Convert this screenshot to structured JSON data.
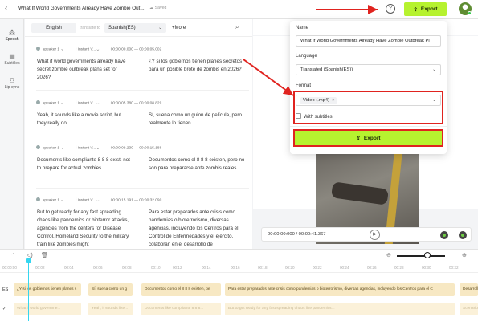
{
  "topbar": {
    "back_icon": "chevron-left-icon",
    "title": "What If World Governments Already Have Zombie Out...",
    "saved": "Saved",
    "help_glyph": "?",
    "export_label": "Export"
  },
  "rail": [
    {
      "label": "Speech",
      "icon": "speech-icon"
    },
    {
      "label": "Subtitles",
      "icon": "subtitles-icon"
    },
    {
      "label": "Lip-sync",
      "icon": "lipsync-icon"
    }
  ],
  "transcript": {
    "source_lang": "English",
    "to_label": "translate to",
    "target_lang": "Spanish(ES)",
    "more_label": "+More",
    "segments": [
      {
        "speaker": "speaker 1",
        "voice": "Instant V...",
        "start": "00:00:00.000",
        "end": "00:00:05.002",
        "en": "What if world governments already have secret zombie outbreak plans set for 2026?",
        "es": "¿Y si los gobiernos tienen planes secretos para un posible brote de zombis en 2026?"
      },
      {
        "speaker": "speaker 1",
        "voice": "Instant V...",
        "start": "00:00:05.380",
        "end": "00:00:08.829",
        "en": "Yeah, it sounds like a movie script, but they really do.",
        "es": "Sí, suena como un guion de película, pero realmente lo tienen."
      },
      {
        "speaker": "speaker 1",
        "voice": "Instant V...",
        "start": "00:00:09.230",
        "end": "00:00:15.188",
        "en": "Documents like compliante 8 8 8 exist, not to prepare for actual zombies.",
        "es": "Documentos como el 8 8 8 existen, pero no son para prepararse ante zombis reales."
      },
      {
        "speaker": "speaker 1",
        "voice": "Instant V...",
        "start": "00:00:15.191",
        "end": "00:00:32.090",
        "en": "But to get ready for any fast spreading chaos like pandemics or bioterror attacks, agencies from the centers for Disease Control, Homeland Security to the military train like zombies might",
        "es": "Para estar preparados ante crisis como pandemias o bioterrorismo, diversas agencias, incluyendo los Centros para el Control de Enfermedades y el ejército, colaboran en el desarrollo de"
      }
    ]
  },
  "export_panel": {
    "name_label": "Name",
    "name_value": "What If World Governments Already Have Zombie Outbreak Pl",
    "language_label": "Language",
    "language_value": "Translated (Spanish(ES))",
    "format_label": "Format",
    "format_value": "Video (.mp4)",
    "subtitles_label": "With subtitles",
    "export_label": "Export"
  },
  "player": {
    "time": "00:00:00:000 / 00:00:41.367"
  },
  "timeline": {
    "ruler": [
      "00:00:00",
      "00:02",
      "00:04",
      "00:06",
      "00:08",
      "00:10",
      "00:12",
      "00:14",
      "00:16",
      "00:18",
      "00:20",
      "00:22",
      "00:24",
      "00:26",
      "00:28",
      "00:30",
      "00:32"
    ],
    "track_es_label": "ES",
    "track_en_label": "✓",
    "es_clips": [
      "¿Y si los gobiernos tienen planes s",
      "Sí, suena como un g",
      "Documentos como el 8 8 8 existen, pe",
      "Para estar preparados ante crisis como pandemias o bioterrorismo, diversas agencias, incluyendo los Centros para el C",
      "Desarrolla"
    ],
    "en_clips": [
      "What if world governme...",
      "Yeah, it sounds like...",
      "Documents like compliante 8 8 8...",
      "But to get ready for any fast spreading chaos like pandemics...",
      "Scenario"
    ]
  },
  "colors": {
    "accent_green": "#b6f22f",
    "annotation_red": "#e0231f",
    "playhead": "#35d6f0"
  }
}
